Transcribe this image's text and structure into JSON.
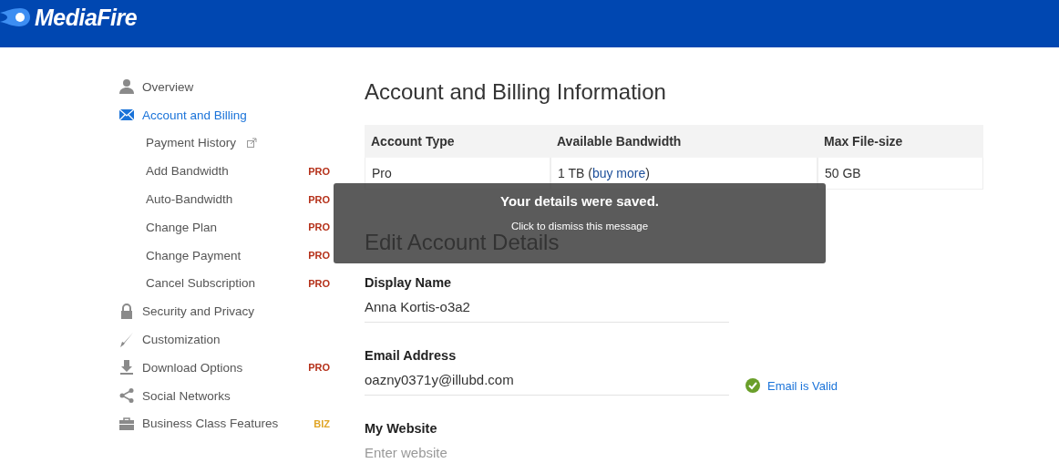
{
  "header": {
    "logo": "MediaFire"
  },
  "sidebar": {
    "items": [
      {
        "label": "Overview",
        "selected": false
      },
      {
        "label": "Account and Billing",
        "selected": true,
        "children": [
          {
            "label": "Payment History",
            "selected": false,
            "external": true
          },
          {
            "label": "Add Bandwidth",
            "selected": false,
            "external": false,
            "badge": "PRO",
            "color": "#b5311a"
          },
          {
            "label": "Auto-Bandwidth",
            "selected": false,
            "external": false,
            "badge": "PRO",
            "color": "#b5311a"
          },
          {
            "label": "Change Plan",
            "selected": false,
            "external": false,
            "badge": "PRO",
            "color": "#b5311a"
          },
          {
            "label": "Change Payment",
            "selected": false,
            "external": false,
            "badge": "PRO",
            "color": "#b5311a"
          },
          {
            "label": "Cancel Subscription",
            "selected": false,
            "external": false,
            "badge": "PRO",
            "color": "#b5311a"
          }
        ]
      },
      {
        "label": "Security and Privacy",
        "selected": false
      },
      {
        "label": "Customization",
        "selected": false
      },
      {
        "label": "Download Options",
        "selected": false,
        "badge": "PRO",
        "color": "#b5311a"
      },
      {
        "label": "Social Networks",
        "selected": false
      },
      {
        "label": "Business Class Features",
        "selected": false,
        "badge": "BIZ",
        "color": "#e0a526"
      }
    ]
  },
  "main": {
    "title": "Account and Billing Information",
    "table": {
      "columns": [
        "Account Type",
        "Available Bandwidth",
        "Max File-size"
      ],
      "rows": [
        [
          {
            "text": "Pro"
          },
          {
            "text": "1 TB (",
            "link": "buy more",
            "suffix": ")"
          },
          {
            "text": "50 GB"
          }
        ]
      ]
    },
    "section_title": "Edit Account Details",
    "fields": [
      {
        "label": "Display Name",
        "value": "Anna Kortis-o3a2"
      },
      {
        "label": "Email Address",
        "value": "oazny0371y@illubd.com",
        "status": "Email is Valid"
      },
      {
        "label": "My Website",
        "placeholder": "Enter website"
      }
    ]
  },
  "toast": {
    "title": "Your details were saved.",
    "hint": "Click to dismiss this message"
  }
}
